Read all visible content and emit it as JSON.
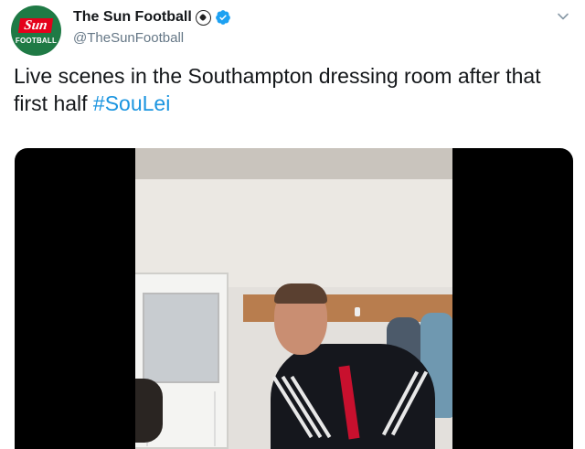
{
  "tweet": {
    "display_name": "The Sun Football",
    "handle": "@TheSunFootball",
    "avatar": {
      "brand": "Sun",
      "label": "FOOTBALL",
      "bg_color": "#1f7a45",
      "logo_color": "#e4001b"
    },
    "name_icons": [
      "football-icon",
      "verified-badge-icon"
    ],
    "text": "Live scenes in the Southampton dressing room after that first half ",
    "hashtag": "#SouLei",
    "hashtag_color": "#1b95e0",
    "verified_color": "#1da1f2",
    "menu_icon": "chevron-down-icon"
  }
}
